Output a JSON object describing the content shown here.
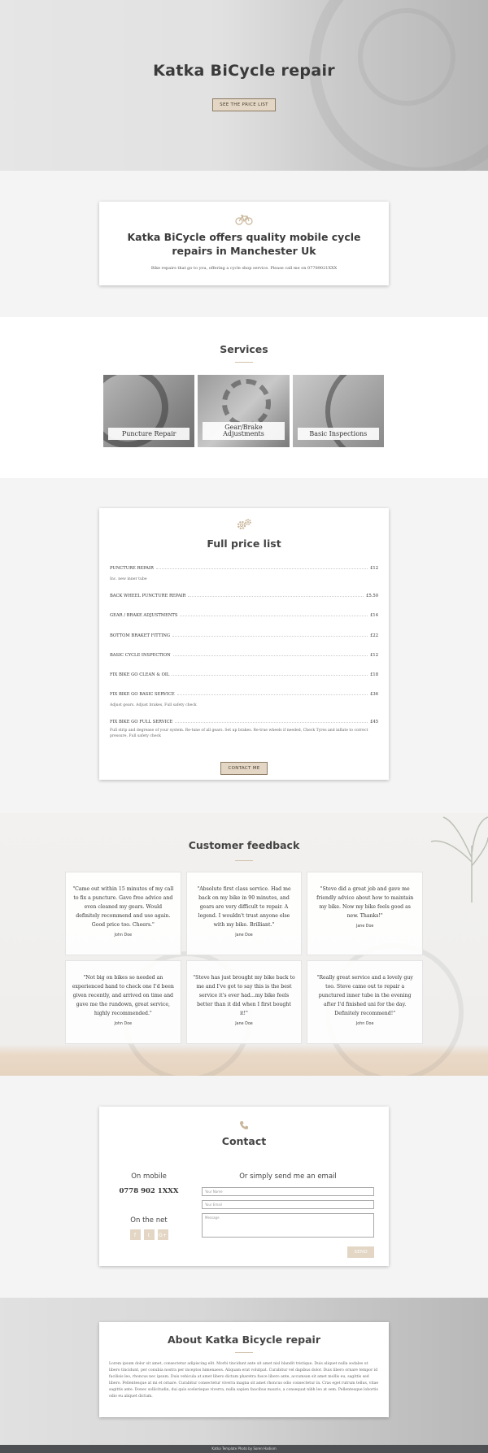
{
  "hero": {
    "title": "Katka BiCycle repair",
    "button_label": "SEE THE PRICE LIST"
  },
  "intro": {
    "icon": "bicycle-icon",
    "heading": "Katka BiCycle offers quality mobile cycle repairs in Manchester Uk",
    "text": "Bike repairs that go to you, offering a cycle shop service. Please call me on 07789021XXX"
  },
  "services": {
    "title": "Services",
    "items": [
      {
        "label": "Puncture Repair"
      },
      {
        "label": "Gear/Brake Adjustments"
      },
      {
        "label": "Basic Inspections"
      }
    ]
  },
  "price_list": {
    "icon": "gears-icon",
    "title": "Full price list",
    "items": [
      {
        "name": "PUNCTURE REPAIR",
        "price": "£12",
        "desc": "Inc. new inner tube"
      },
      {
        "name": "BACK WHEEL PUNCTURE REPAIR",
        "price": "£5.50",
        "desc": ""
      },
      {
        "name": "GEAR / BRAKE ADJUSTMENTS",
        "price": "£14",
        "desc": ""
      },
      {
        "name": "BOTTOM BRAKET FITTING",
        "price": "£22",
        "desc": ""
      },
      {
        "name": "BASIC CYCLE INSPECTION",
        "price": "£12",
        "desc": ""
      },
      {
        "name": "FIX BIKE GO CLEAN & OIL",
        "price": "£18",
        "desc": ""
      },
      {
        "name": "FIX BIKE GO BASIC SERVICE",
        "price": "£36",
        "desc": "Adjust gears. Adjust brakes, Full safety check"
      },
      {
        "name": "FIX BIKE GO FULL SERVICE",
        "price": "£45",
        "desc": "Full strip and degrease of your system. Re-tune of all gears. Set up brakes. Re-true wheels if needed, Check Tyres and inflate to correct pressure, Full safety check"
      }
    ],
    "button_label": "CONTACT ME"
  },
  "feedback": {
    "title": "Customer feedback",
    "items": [
      {
        "quote": "\"Came out within 15 minutes of my call to fix a puncture. Gave free advice and even cleaned my gears. Would definitely recommend and use again. Good price too. Cheers.\"",
        "author": "John Doe"
      },
      {
        "quote": "\"Absolute first class service. Had me back on my bike in 90 minutes, and gears are very difficult to repair. A legend. I wouldn't trust anyone else with my bike. Brilliant.\"",
        "author": "Jane Doe"
      },
      {
        "quote": "\"Steve did a great job and gave me friendly advice about how to maintain my bike. Now my bike feels good as new. Thanks!\"",
        "author": "Jane Doe"
      },
      {
        "quote": "\"Not big on bikes so needed an experienced hand to check one I'd been given recently, and arrived on time and gave me the rundown, great service, highly recommended.\"",
        "author": "John Doe"
      },
      {
        "quote": "\"Steve has just brought my bike back to me and I've got to say this is the best service it's ever had...my bike feels better than it did when I first bought it!\"",
        "author": "Jane Doe"
      },
      {
        "quote": "\"Really great service and a lovely guy too. Steve came out to repair a punctured inner tube in the evening after I'd finished uni for the day. Definitely recommend!\"",
        "author": "John Doe"
      }
    ]
  },
  "contact": {
    "icon": "phone-icon",
    "title": "Contact",
    "mobile_title": "On mobile",
    "mobile_number": "0778 902 1XXX",
    "net_title": "On the net",
    "social": [
      {
        "icon": "facebook-icon",
        "glyph": "f"
      },
      {
        "icon": "twitter-icon",
        "glyph": "t"
      },
      {
        "icon": "google-plus-icon",
        "glyph": "G+"
      }
    ],
    "email_title": "Or simply send me an email",
    "name_placeholder": "Your Name",
    "email_placeholder": "Your Email",
    "message_placeholder": "Message",
    "send_label": "SEND"
  },
  "about": {
    "title": "About Katka Bicycle repair",
    "text": "Lorem ipsum dolor sit amet, consectetur adipiscing elit. Morbi tincidunt ante sit amet nisl blandit tristique. Duis aliquet nulla sodales ut libero tincidunt, per conubia nostra per inceptos himenaeos. Aliquam erat volutpat. Curabitur vel dapibus dolor. Duis libero ornare tempor id facilisis leo, rhoncus nec ipsum. Duis vehicula at amet libero dictum pharetra fusce libero ante, accumsan sit amet mollis eu, sagittis sed libero. Pellentesque at mi et ornare. Curabitur consectetur viverra magna sit amet rhoncus odio consectetur in. Cras eget rutrum tellus, vitae sagittis ante. Donec sollicitudin, dui quis scelerisque viverra, nulla sapien faucibus mauris, a consequat nibh leo at sem. Pellentesque lobortis odio eu aliquet dictum."
  },
  "footer": {
    "text": "Katka Template Photo by Soren Hadiom"
  }
}
